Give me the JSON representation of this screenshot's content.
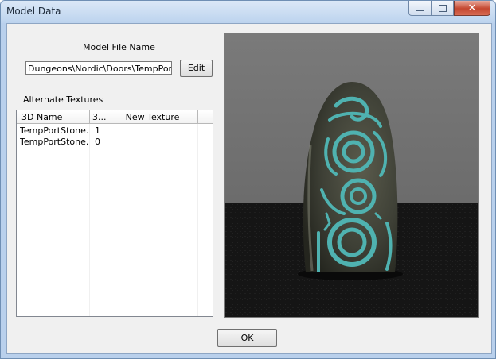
{
  "window": {
    "title": "Model Data"
  },
  "model_file": {
    "label": "Model File Name",
    "value": "Dungeons\\Nordic\\Doors\\TempPortS",
    "edit_label": "Edit"
  },
  "textures": {
    "label": "Alternate Textures",
    "columns": [
      "3D Name",
      "3...",
      "New Texture"
    ],
    "rows": [
      {
        "name": "TempPortStone...",
        "index": "1",
        "new_texture": ""
      },
      {
        "name": "TempPortStone...",
        "index": "0",
        "new_texture": ""
      }
    ]
  },
  "footer": {
    "ok_label": "OK"
  },
  "preview": {
    "floor_color": "#161616",
    "background_color": "#767676",
    "stone_color": "#3e4036",
    "rune_color": "#4fb2b0"
  }
}
